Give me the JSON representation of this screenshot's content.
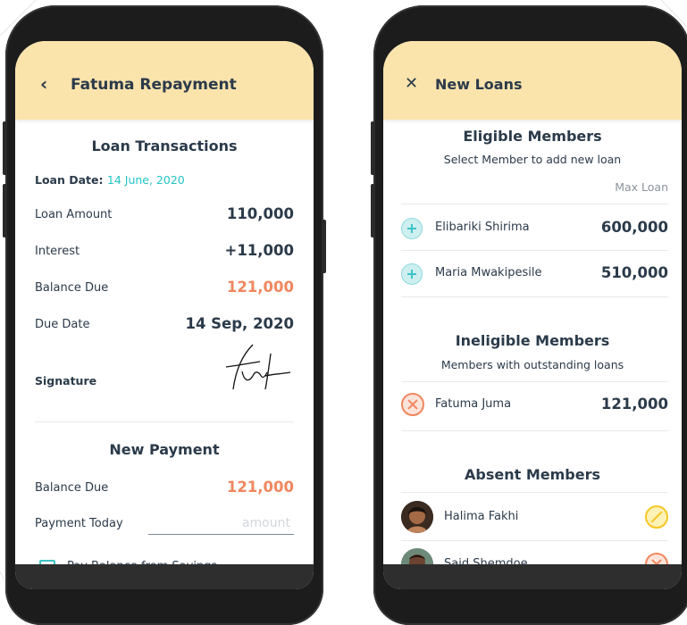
{
  "left_phone": {
    "header": {
      "back_icon": "chevron-left-icon",
      "title": "Fatuma Repayment"
    },
    "loan_transactions": {
      "title": "Loan Transactions",
      "loan_date_label": "Loan Date:",
      "loan_date_value": "14 June, 2020",
      "rows": [
        {
          "label": "Loan Amount",
          "value": "110,000"
        },
        {
          "label": "Interest",
          "value": "+11,000"
        },
        {
          "label": "Balance Due",
          "value": "121,000"
        },
        {
          "label": "Due Date",
          "value": "14 Sep, 2020"
        }
      ],
      "signature_label": "Signature"
    },
    "new_payment": {
      "title": "New Payment",
      "balance_due_label": "Balance Due",
      "balance_due_value": "121,000",
      "payment_today_label": "Payment Today",
      "payment_placeholder": "amount",
      "pay_from_savings_label": "Pay Balance from Savings"
    }
  },
  "right_phone": {
    "header": {
      "close_icon": "close-icon",
      "title": "New Loans"
    },
    "eligible": {
      "title": "Eligible Members",
      "subtitle": "Select Member to add new loan",
      "column_header": "Max Loan",
      "members": [
        {
          "name": "Elibariki Shirima",
          "amount": "600,000",
          "icon": "add-circle-icon"
        },
        {
          "name": "Maria Mwakipesile",
          "amount": "510,000",
          "icon": "add-circle-icon"
        }
      ]
    },
    "ineligible": {
      "title": "Ineligible Members",
      "subtitle": "Members with outstanding loans",
      "members": [
        {
          "name": "Fatuma Juma",
          "amount": "121,000",
          "icon": "cancel-circle-icon"
        }
      ]
    },
    "absent": {
      "title": "Absent Members",
      "members": [
        {
          "name": "Halima Fakhi",
          "icon": "excused-icon"
        },
        {
          "name": "Said Shemdoe",
          "icon": "cancel-circle-icon"
        }
      ]
    }
  },
  "colors": {
    "header_bg": "#fbe3ac",
    "accent_cyan": "#23c4c6",
    "accent_orange": "#f0875f",
    "accent_yellow": "#f5c623",
    "text_dark": "#2b3a4a"
  }
}
